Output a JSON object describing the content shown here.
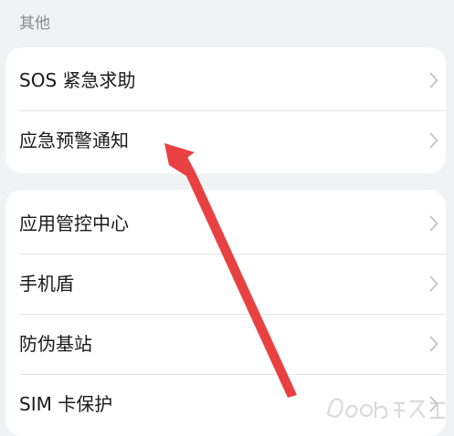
{
  "section": {
    "label": "其他"
  },
  "group1": {
    "items": [
      {
        "label": "SOS 紧急求助"
      },
      {
        "label": "应急预警通知"
      }
    ]
  },
  "group2": {
    "items": [
      {
        "label": "应用管控中心"
      },
      {
        "label": "手机盾"
      },
      {
        "label": "防伪基站"
      },
      {
        "label": "SIM 卡保护"
      }
    ]
  },
  "icons": {
    "chevron": "chevron-right-icon",
    "annotation": "red-arrow-annotation",
    "watermark": "baidu-jingyan-watermark"
  },
  "colors": {
    "background": "#f1f2f4",
    "card": "#ffffff",
    "text": "#1a1a1a",
    "label": "#8a8a8a",
    "chevron": "#c4c4c4",
    "arrow": "#e84141"
  }
}
